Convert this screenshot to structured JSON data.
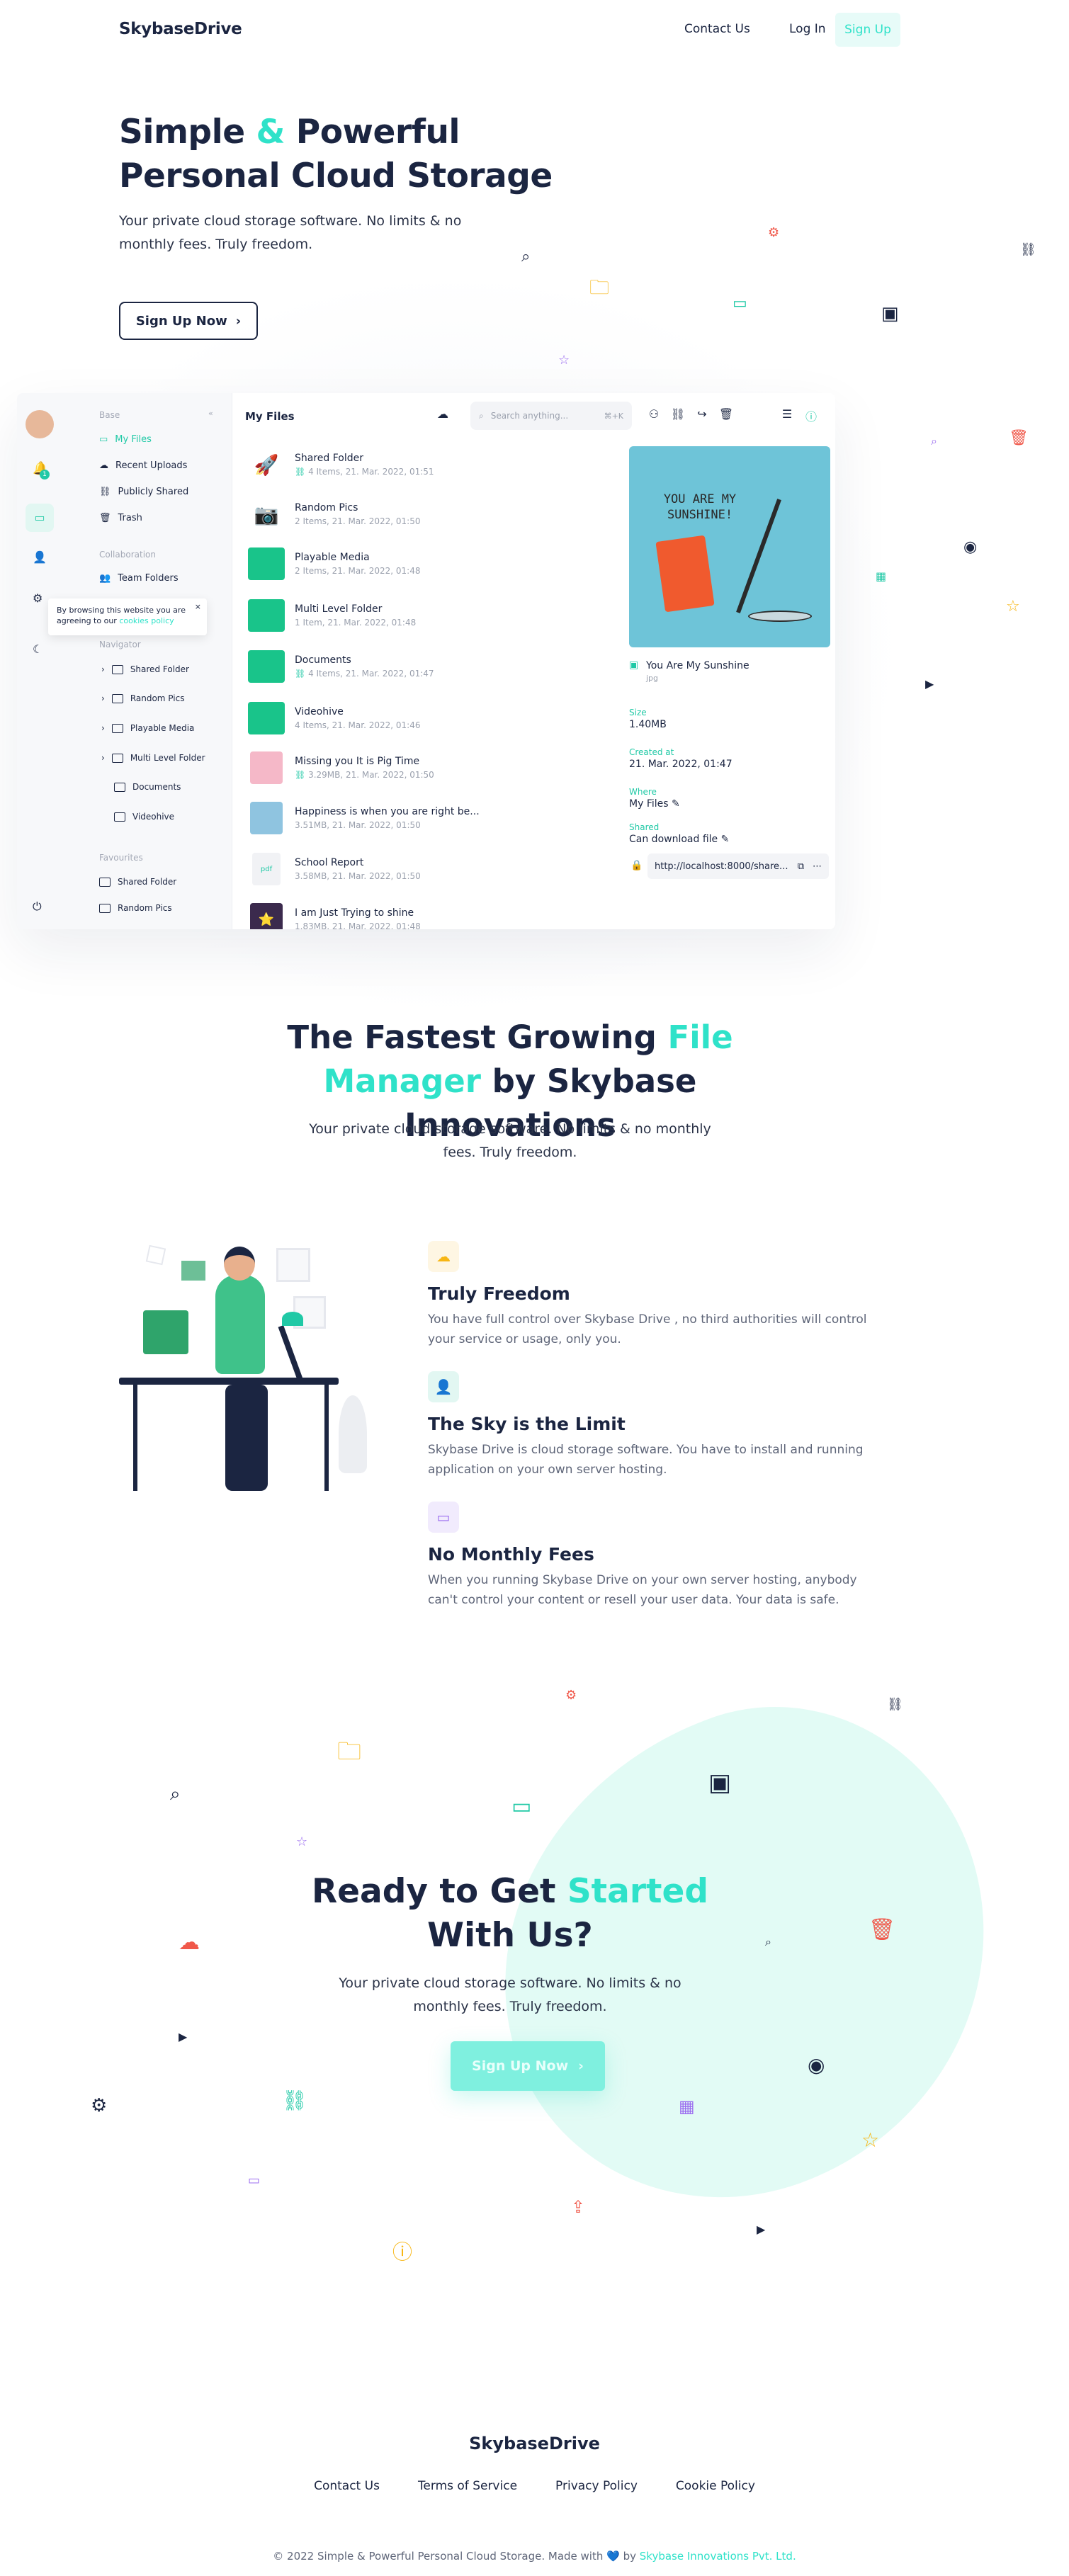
{
  "header": {
    "logo": "SkybaseDrive",
    "nav": {
      "contact": "Contact Us",
      "login": "Log In",
      "signup": "Sign Up"
    }
  },
  "hero": {
    "title_pre": "Simple ",
    "title_amp": "&",
    "title_post": " Powerful Personal Cloud Storage",
    "subtitle": "Your private cloud storage software. No limits & no monthly fees. Truly freedom.",
    "cta": "Sign Up Now",
    "cta_icon": "chevron-right-icon"
  },
  "app": {
    "sidebar": {
      "section_base": "Base",
      "base_items": [
        "My Files",
        "Recent Uploads",
        "Publicly Shared",
        "Trash"
      ],
      "section_collab": "Collaboration",
      "collab_items": [
        "Team Folders"
      ],
      "cookie_text": "By browsing this website you are agreeing to our ",
      "cookie_link": "cookies policy",
      "section_nav": "Navigator",
      "nav_items": [
        "Shared Folder",
        "Random Pics",
        "Playable Media",
        "Multi Level Folder",
        "Documents",
        "Videohive"
      ],
      "section_fav": "Favourites",
      "fav_items": [
        "Shared Folder",
        "Random Pics"
      ],
      "badge_count": "1"
    },
    "toolbar": {
      "title": "My Files",
      "search_placeholder": "Search anything...",
      "search_shortcut": "⌘+K"
    },
    "files": [
      {
        "name": "Shared Folder",
        "meta": "4 Items, 21. Mar. 2022, 01:51",
        "icon": "rocket-icon",
        "shared": true
      },
      {
        "name": "Random Pics",
        "meta": "2 Items, 21. Mar. 2022, 01:50",
        "icon": "camera-icon",
        "shared": false
      },
      {
        "name": "Playable Media",
        "meta": "2 Items, 21. Mar. 2022, 01:48",
        "icon": "folder-icon",
        "shared": false
      },
      {
        "name": "Multi Level Folder",
        "meta": "1 Item, 21. Mar. 2022, 01:48",
        "icon": "folder-icon",
        "shared": false
      },
      {
        "name": "Documents",
        "meta": "4 Items, 21. Mar. 2022, 01:47",
        "icon": "folder-icon",
        "shared": true
      },
      {
        "name": "Videohive",
        "meta": "4 Items, 21. Mar. 2022, 01:46",
        "icon": "folder-icon",
        "shared": false
      },
      {
        "name": "Missing you It is Pig Time",
        "meta": "3.29MB, 21. Mar. 2022, 01:50",
        "icon": "image-thumb-icon",
        "shared": true
      },
      {
        "name": "Happiness is when you are right be...",
        "meta": "3.51MB, 21. Mar. 2022, 01:50",
        "icon": "image-thumb-icon",
        "shared": false
      },
      {
        "name": "School Report",
        "meta": "3.58MB, 21. Mar. 2022, 01:50",
        "icon": "pdf-icon",
        "shared": false
      },
      {
        "name": "I am Just Trying to shine",
        "meta": "1.83MB, 21. Mar. 2022, 01:48",
        "icon": "image-thumb-icon",
        "shared": false
      }
    ],
    "detail": {
      "poster_text": "YOU ARE MY SUNSHINE!",
      "name": "You Are My Sunshine",
      "ext": "jpg",
      "size_label": "Size",
      "size": "1.40MB",
      "created_label": "Created at",
      "created": "21. Mar. 2022, 01:47",
      "where_label": "Where",
      "where": "My Files",
      "shared_label": "Shared",
      "shared": "Can download file",
      "link": "http://localhost:8000/share..."
    }
  },
  "section2": {
    "title_a": "The Fastest Growing ",
    "title_b": "File Manager",
    "title_c": " by Skybase Innovations",
    "subtitle": "Your private cloud storage software. No limits & no monthly fees. Truly freedom.",
    "features": [
      {
        "title": "Truly Freedom",
        "desc": "You have full control over Skybase Drive , no third authorities will control your service or usage, only you.",
        "icon": "cloud-icon",
        "color": "#f7b614"
      },
      {
        "title": "The Sky is the Limit",
        "desc": "Skybase Drive is cloud storage software. You have to install and running application on your own server hosting.",
        "icon": "user-icon",
        "color": "#20c9a6"
      },
      {
        "title": "No Monthly Fees",
        "desc": "When you running Skybase Drive on your own server hosting, anybody can't control your content or resell your user data. Your data is safe.",
        "icon": "hard-drive-icon",
        "color": "#9b6cf0"
      }
    ]
  },
  "section3": {
    "title_a": "Ready to Get ",
    "title_b": "Started",
    "title_c": "With Us?",
    "subtitle": "Your private cloud storage software. No limits & no monthly fees. Truly freedom.",
    "cta": "Sign Up Now"
  },
  "footer": {
    "logo": "SkybaseDrive",
    "links": [
      "Contact Us",
      "Terms of Service",
      "Privacy Policy",
      "Cookie Policy"
    ],
    "copy_pre": "© 2022 Simple & Powerful Personal Cloud Storage. Made with ",
    "heart": "💙",
    "copy_by": " by ",
    "copy_link": "Skybase Innovations Pvt. Ltd."
  },
  "colors": {
    "accent": "#2fe2c9",
    "text": "#1b2541",
    "green": "#20c9a6",
    "red": "#f0584a",
    "yellow": "#f7b614",
    "purple": "#9b6cf0"
  }
}
